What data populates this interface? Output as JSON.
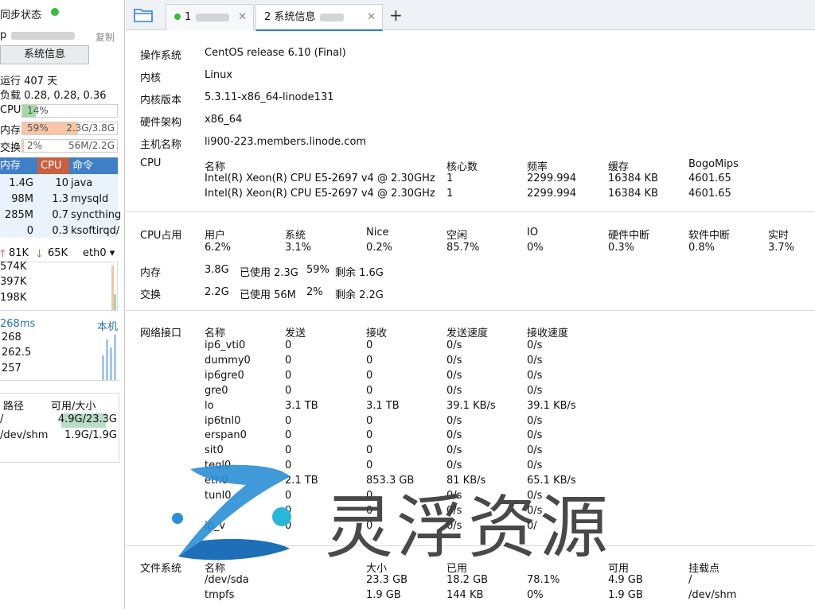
{
  "sidebar": {
    "sync_label": "同步状态",
    "host_prefix": "p",
    "copy_label": "复制",
    "sysinfo_button": "系统信息",
    "uptime": "运行 407 天",
    "load": "负载 0.28, 0.28, 0.36",
    "cpu": {
      "label": "CPU",
      "text": "14%",
      "percent": 14
    },
    "mem": {
      "label": "内存",
      "percent_text": "59%",
      "detail": "2.3G/3.8G",
      "percent": 59
    },
    "swap": {
      "label": "交换",
      "percent_text": "2%",
      "detail": "56M/2.2G",
      "percent": 2
    },
    "proc_headers": [
      "内存",
      "CPU",
      "命令"
    ],
    "processes": [
      {
        "mem": "1.4G",
        "cpu": "10",
        "cmd": "java"
      },
      {
        "mem": "98M",
        "cpu": "1.3",
        "cmd": "mysqld"
      },
      {
        "mem": "285M",
        "cpu": "0.7",
        "cmd": "syncthing"
      },
      {
        "mem": "0",
        "cpu": "0.3",
        "cmd": "ksoftirqd/"
      }
    ],
    "net": {
      "up": "81K",
      "down": "65K",
      "iface": "eth0",
      "scale": [
        "574K",
        "397K",
        "198K"
      ]
    },
    "ping": {
      "value": "268ms",
      "target": "本机",
      "scale": [
        "268",
        "262.5",
        "257"
      ]
    },
    "disk_headers": [
      "路径",
      "可用/大小"
    ],
    "disks": [
      {
        "path": "/",
        "usage": "4.9G/23.3G",
        "percent": 79
      },
      {
        "path": "/dev/shm",
        "usage": "1.9G/1.9G",
        "percent": 0
      }
    ]
  },
  "tabs": [
    {
      "label": "1",
      "active": false
    },
    {
      "label": "2 系统信息",
      "active": true
    }
  ],
  "add_tab": "+",
  "info": {
    "os": {
      "label": "操作系统",
      "value": "CentOS release 6.10 (Final)"
    },
    "kernel": {
      "label": "内核",
      "value": "Linux"
    },
    "kernel_version": {
      "label": "内核版本",
      "value": "5.3.11-x86_64-linode131"
    },
    "arch": {
      "label": "硬件架构",
      "value": "x86_64"
    },
    "hostname": {
      "label": "主机名称",
      "value": "li900-223.members.linode.com"
    }
  },
  "cpu": {
    "label": "CPU",
    "headers": [
      "名称",
      "核心数",
      "频率",
      "缓存",
      "BogoMips"
    ],
    "rows": [
      [
        "Intel(R) Xeon(R) CPU E5-2697 v4 @ 2.30GHz",
        "1",
        "2299.994",
        "16384 KB",
        "4601.65"
      ],
      [
        "Intel(R) Xeon(R) CPU E5-2697 v4 @ 2.30GHz",
        "1",
        "2299.994",
        "16384 KB",
        "4601.65"
      ]
    ]
  },
  "cpu_usage": {
    "label": "CPU占用",
    "headers": [
      "用户",
      "系统",
      "Nice",
      "空闲",
      "IO",
      "硬件中断",
      "软件中断",
      "实时"
    ],
    "values": [
      "6.2%",
      "3.1%",
      "0.2%",
      "85.7%",
      "0%",
      "0.3%",
      "0.8%",
      "3.7%"
    ]
  },
  "memory": {
    "label": "内存",
    "total": "3.8G",
    "used": "已使用 2.3G",
    "pct": "59%",
    "free": "剩余 1.6G"
  },
  "swap": {
    "label": "交换",
    "total": "2.2G",
    "used": "已使用 56M",
    "pct": "2%",
    "free": "剩余 2.2G"
  },
  "network": {
    "label": "网络接口",
    "headers": [
      "名称",
      "发送",
      "接收",
      "发送速度",
      "接收速度"
    ],
    "rows": [
      [
        "ip6_vti0",
        "0",
        "0",
        "0/s",
        "0/s"
      ],
      [
        "dummy0",
        "0",
        "0",
        "0/s",
        "0/s"
      ],
      [
        "ip6gre0",
        "0",
        "0",
        "0/s",
        "0/s"
      ],
      [
        "gre0",
        "0",
        "0",
        "0/s",
        "0/s"
      ],
      [
        "lo",
        "3.1 TB",
        "3.1 TB",
        "39.1 KB/s",
        "39.1 KB/s"
      ],
      [
        "ip6tnl0",
        "0",
        "0",
        "0/s",
        "0/s"
      ],
      [
        "erspan0",
        "0",
        "0",
        "0/s",
        "0/s"
      ],
      [
        "sit0",
        "0",
        "0",
        "0/s",
        "0/s"
      ],
      [
        "teql0",
        "0",
        "0",
        "0/s",
        "0/s"
      ],
      [
        "eth0",
        "2.1 TB",
        "853.3 GB",
        "81 KB/s",
        "65.1 KB/s"
      ],
      [
        "tunl0",
        "0",
        "0",
        "0/s",
        "0/s"
      ],
      [
        "",
        "0",
        "0",
        "0/s",
        "0/s"
      ],
      [
        "ip_v",
        "0",
        "0",
        "0/s",
        "0/"
      ]
    ]
  },
  "filesystem": {
    "label": "文件系统",
    "headers": [
      "名称",
      "大小",
      "已用",
      "",
      "可用",
      "挂载点"
    ],
    "rows": [
      [
        "/dev/sda",
        "23.3 GB",
        "18.2 GB",
        "78.1%",
        "4.9 GB",
        "/"
      ],
      [
        "tmpfs",
        "1.9 GB",
        "144 KB",
        "0%",
        "1.9 GB",
        "/dev/shm"
      ]
    ]
  },
  "watermark": "灵浮资源",
  "colors": {
    "cpu_fill": "#a6d8a6",
    "mem_fill": "#f7c6a8",
    "proc_header": "#3f7fc8",
    "proc_cpu_header": "#c86040",
    "selected_tab": "#2f7ad8",
    "online_dot": "#3cba3c"
  }
}
